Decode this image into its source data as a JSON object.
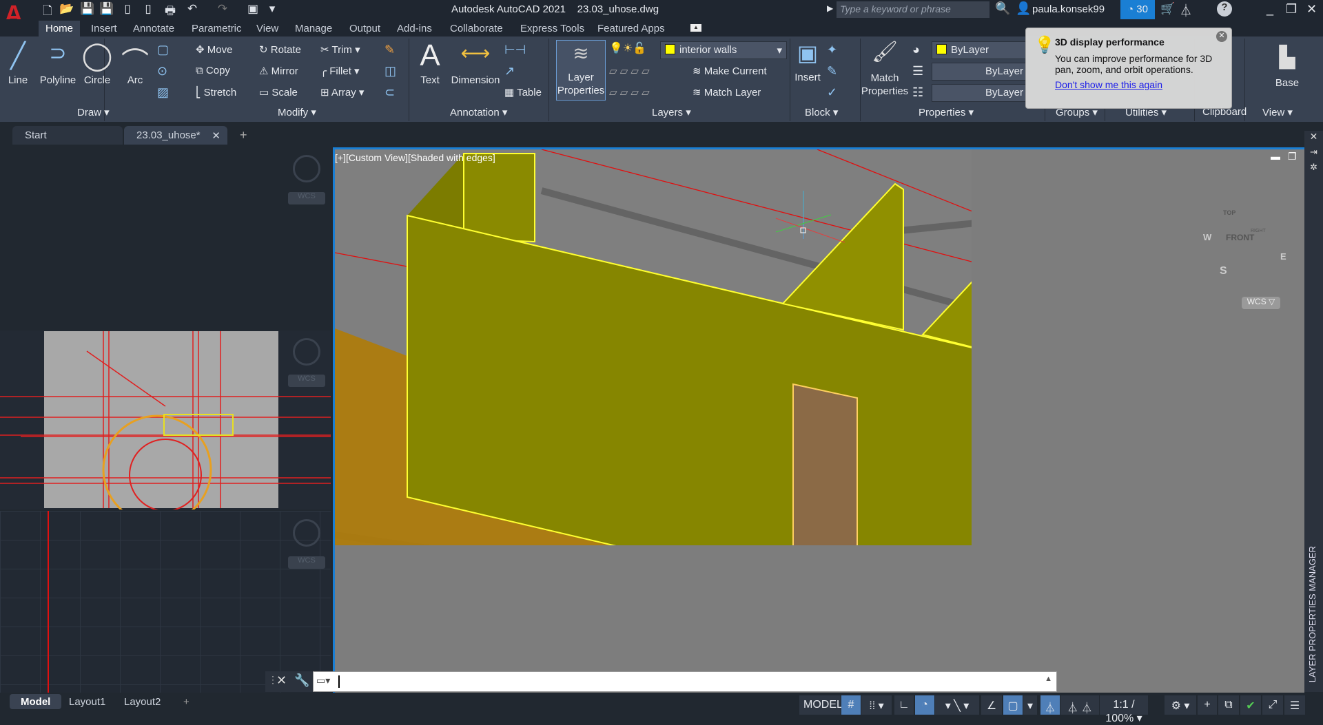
{
  "app": {
    "title": "Autodesk AutoCAD 2021",
    "file": "23.03_uhose.dwg",
    "logo": "A"
  },
  "search": {
    "placeholder": "Type a keyword or phrase"
  },
  "user": {
    "name": "paula.konsek99",
    "timer": "30"
  },
  "ribbon_tabs": [
    "Home",
    "Insert",
    "Annotate",
    "Parametric",
    "View",
    "Manage",
    "Output",
    "Add-ins",
    "Collaborate",
    "Express Tools",
    "Featured Apps"
  ],
  "draw": {
    "title": "Draw",
    "line": "Line",
    "polyline": "Polyline",
    "circle": "Circle",
    "arc": "Arc"
  },
  "modify": {
    "title": "Modify",
    "move": "Move",
    "rotate": "Rotate",
    "trim": "Trim",
    "copy": "Copy",
    "mirror": "Mirror",
    "fillet": "Fillet",
    "stretch": "Stretch",
    "scale": "Scale",
    "array": "Array"
  },
  "annotation": {
    "title": "Annotation",
    "text": "Text",
    "dimension": "Dimension",
    "table": "Table"
  },
  "layers": {
    "title": "Layers",
    "layer_properties": "Layer Properties",
    "current_layer": "interior walls",
    "make_current": "Make Current",
    "match_layer": "Match Layer",
    "layer_color": "#ffff00"
  },
  "block": {
    "title": "Block",
    "insert": "Insert"
  },
  "properties": {
    "title": "Properties",
    "match": "Match Properties",
    "color": "ByLayer",
    "linetype": "ByLayer",
    "lineweight": "ByLayer"
  },
  "other_panels": {
    "groups": "Groups",
    "utilities": "Utilities",
    "clipboard": "Clipboard",
    "view": "View",
    "base": "Base"
  },
  "tooltip": {
    "title": "3D display performance",
    "body": "You can improve performance for 3D pan, zoom, and orbit operations.",
    "link": "Don't show me this again"
  },
  "doc_tabs": [
    "Start",
    "23.03_uhose*"
  ],
  "viewport": {
    "label": "[+][Custom View][Shaded with edges]",
    "viewcube": {
      "top": "TOP",
      "front": "FRONT",
      "right": "RIGHT",
      "w": "W",
      "s": "S",
      "e": "E"
    },
    "ucs": "WCS",
    "wall_color": "#808000",
    "door_color": "#8b6a46"
  },
  "left_viewports": {
    "ucs": "WCS"
  },
  "palette": {
    "label": "LAYER PROPERTIES MANAGER"
  },
  "layout_tabs": [
    "Model",
    "Layout1",
    "Layout2"
  ],
  "status": {
    "model": "MODEL",
    "scale": "1:1 / 100%"
  }
}
